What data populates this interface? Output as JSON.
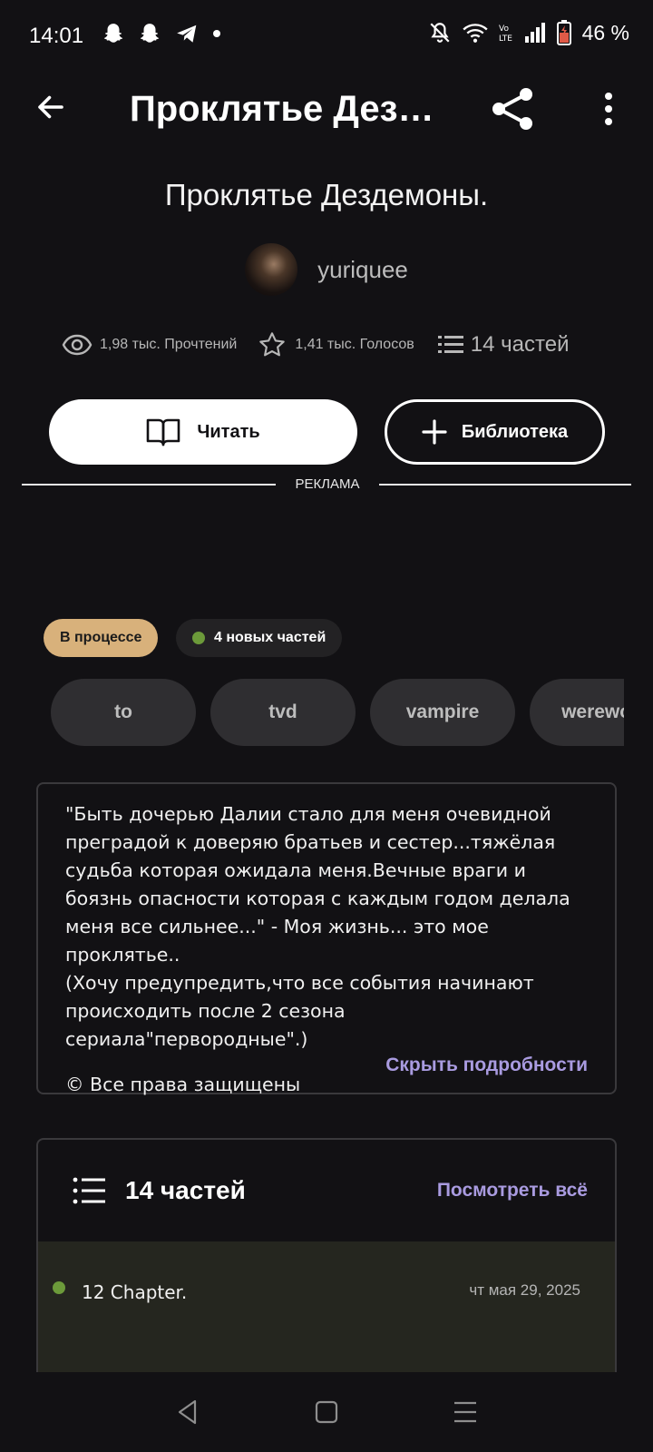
{
  "status_bar": {
    "time": "14:01",
    "icons_left": [
      "snapchat-icon",
      "snapchat-icon",
      "telegram-icon",
      "dot-icon"
    ],
    "icons_right": [
      "mute-notifications-icon",
      "wifi-icon",
      "volte-icon",
      "signal-icon",
      "battery-icon"
    ],
    "battery": "46 %"
  },
  "app_bar": {
    "title": "Проклятье Дезд...",
    "back_icon": "arrow-left-icon",
    "share_icon": "share-icon",
    "more_icon": "more-vertical-icon"
  },
  "story": {
    "title": "Проклятье Дездемоны.",
    "author": "yuriquee"
  },
  "stats": {
    "reads": "1,98 тыс. Прочтений",
    "votes": "1,41 тыс. Голосов",
    "parts": "14 частей"
  },
  "actions": {
    "read_label": "Читать",
    "library_label": "Библиотека"
  },
  "ad_label": "РЕКЛАМА",
  "badges": {
    "status": "В процессе",
    "new_parts": "4 новых частей"
  },
  "tags": [
    "to",
    "tvd",
    "vampire",
    "werewolf"
  ],
  "description": {
    "text": "\"Быть дочерью Далии стало для меня очевидной преградой к доверяю братьев и сестер...тяжёлая судьба которая ожидала меня.Вечные враги и боязнь опасности которая с каждым годом делала меня все сильнее...\" - Моя жизнь... это мое проклятье..\n(Хочу предупредить,что все события начинают происходить после 2 сезона сериала\"первородные\".)",
    "copyright": "© Все права защищены",
    "hide_label": "Скрыть подробности"
  },
  "parts_section": {
    "title": "14 частей",
    "view_all": "Посмотреть всё",
    "chapters": [
      {
        "name": "12 Chapter.",
        "date": "чт мая 29, 2025"
      }
    ]
  },
  "colors": {
    "background": "#121114",
    "badge_status": "#d8b17b",
    "accent_link": "#a99be0",
    "new_dot": "#6c9a3a"
  }
}
